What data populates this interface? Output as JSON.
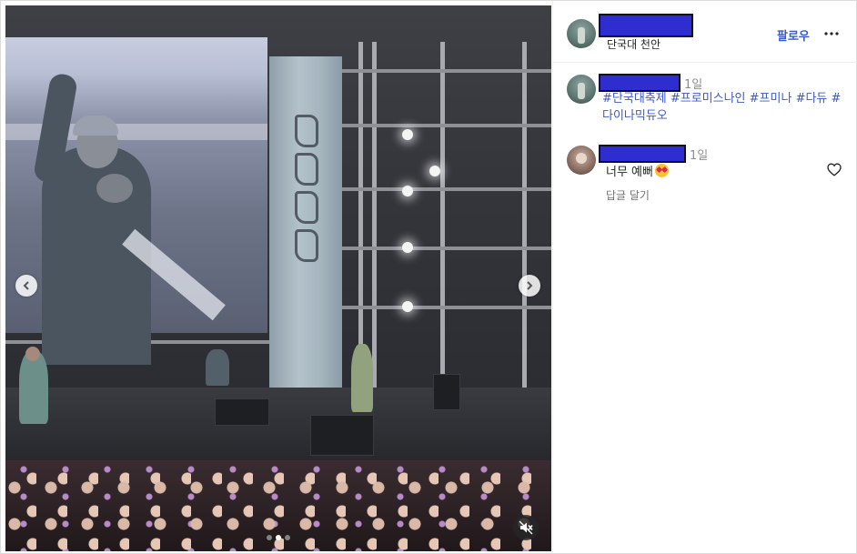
{
  "post": {
    "location": "단국대 천안",
    "follow_label": "팔로우",
    "more_label": "더 보기"
  },
  "carousel": {
    "slide_count": 3,
    "active_index": 1
  },
  "caption": {
    "time": "1일",
    "hashtags": [
      "#단국대축제",
      "#프로미스나인",
      "#프미나",
      "#다듀",
      "#다이나믹듀오"
    ]
  },
  "comments": [
    {
      "text": "너무 예뻐",
      "emoji": "smiling-face-with-heart-eyes",
      "time": "1일",
      "reply_label": "답글 달기"
    }
  ],
  "colors": {
    "link_blue": "#3a59c9",
    "redaction": "#2d2dd0",
    "text_primary": "#262626",
    "text_secondary": "#8e8e8e"
  }
}
